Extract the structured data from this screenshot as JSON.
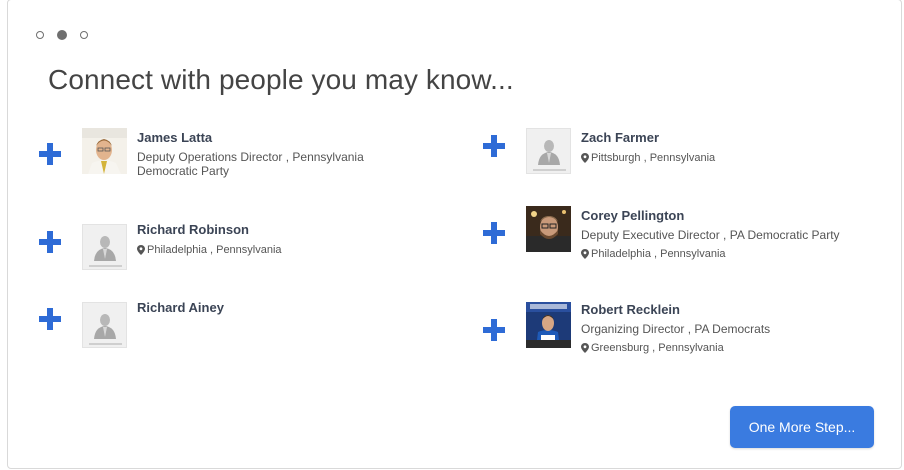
{
  "progress": {
    "steps": 3,
    "current_step": 2
  },
  "title": "Connect with people you may know...",
  "people": [
    {
      "name": "James Latta",
      "job": "Deputy Operations Director , Pennsylvania Democratic Party",
      "location": "",
      "avatar": "photo"
    },
    {
      "name": "Zach Farmer",
      "job": "",
      "location": "Pittsburgh , Pennsylvania",
      "avatar": "photo-not-available"
    },
    {
      "name": "Richard Robinson",
      "job": "",
      "location": "Philadelphia , Pennsylvania",
      "avatar": "photo-not-available"
    },
    {
      "name": "Corey Pellington",
      "job": "Deputy Executive Director , PA Democratic Party",
      "location": "Philadelphia , Pennsylvania",
      "avatar": "photo"
    },
    {
      "name": "Richard Ainey",
      "job": "",
      "location": "",
      "avatar": "photo-not-available"
    },
    {
      "name": "Robert Recklein",
      "job": "Organizing Director , PA Democrats",
      "location": "Greensburg , Pennsylvania",
      "avatar": "photo"
    }
  ],
  "next_button": "One More Step...",
  "colors": {
    "accent": "#2e6bd6",
    "button": "#3a7be0"
  }
}
